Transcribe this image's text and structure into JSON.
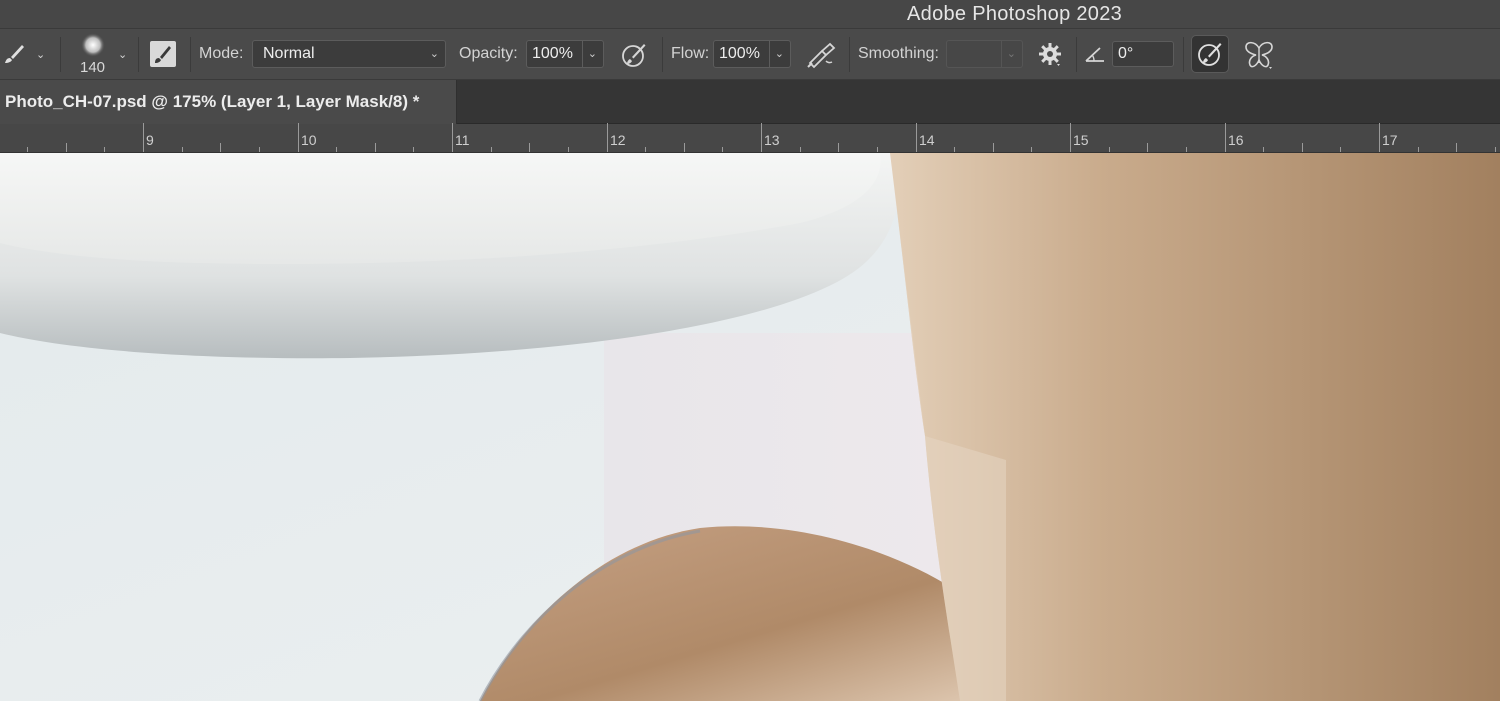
{
  "app": {
    "title": "Adobe Photoshop 2023"
  },
  "options_bar": {
    "tool_icon": "brush-icon",
    "brush_size": "140",
    "mode_label": "Mode:",
    "mode_value": "Normal",
    "opacity_label": "Opacity:",
    "opacity_value": "100%",
    "flow_label": "Flow:",
    "flow_value": "100%",
    "smoothing_label": "Smoothing:",
    "smoothing_value": "",
    "angle_value": "0°"
  },
  "document": {
    "tab_title": "Photo_CH-07.psd @ 175% (Layer 1, Layer Mask/8) *"
  },
  "ruler": {
    "labels": [
      "9",
      "10",
      "11",
      "12",
      "13",
      "14",
      "15",
      "16",
      "17"
    ]
  },
  "colors": {
    "chrome": "#4a4a4a",
    "tab_bar": "#353535",
    "skin": "#b08d6e",
    "plate": "#e9ebea"
  }
}
